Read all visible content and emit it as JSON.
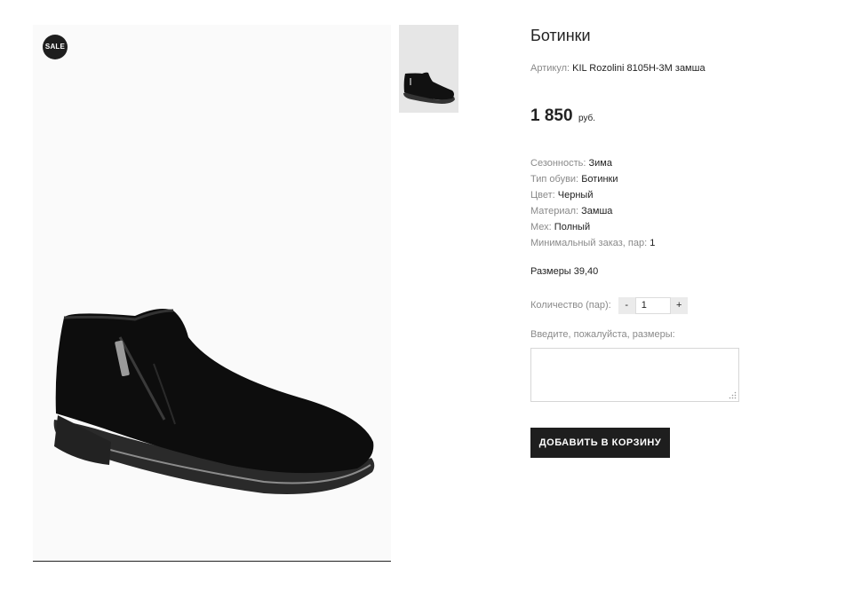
{
  "product": {
    "badge": "SALE",
    "title": "Ботинки",
    "sku_label": "Артикул:",
    "sku_value": "KIL Rozolini 8105H-3M замша",
    "price_amount": "1 850",
    "price_currency": "руб.",
    "attributes": [
      {
        "label": "Сезонность:",
        "value": "Зима"
      },
      {
        "label": "Тип обуви:",
        "value": "Ботинки"
      },
      {
        "label": "Цвет:",
        "value": "Черный"
      },
      {
        "label": "Материал:",
        "value": "Замша"
      },
      {
        "label": "Мех:",
        "value": "Полный"
      },
      {
        "label": "Минимальный заказ, пар:",
        "value": "1"
      }
    ],
    "sizes_text": "Размеры 39,40"
  },
  "order": {
    "qty_label": "Количество (пар):",
    "qty_minus": "-",
    "qty_value": "1",
    "qty_plus": "+",
    "sizes_prompt": "Введите, пожалуйста, размеры:",
    "sizes_input_value": "",
    "add_to_cart_label": "ДОБАВИТЬ В КОРЗИНУ"
  },
  "colors": {
    "dark": "#1e1e1e",
    "muted_text": "#8a8a8a",
    "thumb_bg": "#e6e6e6",
    "image_bg": "#fafafa"
  },
  "icons": {
    "badge": "sale-badge",
    "resize": "resize-grip-icon"
  }
}
